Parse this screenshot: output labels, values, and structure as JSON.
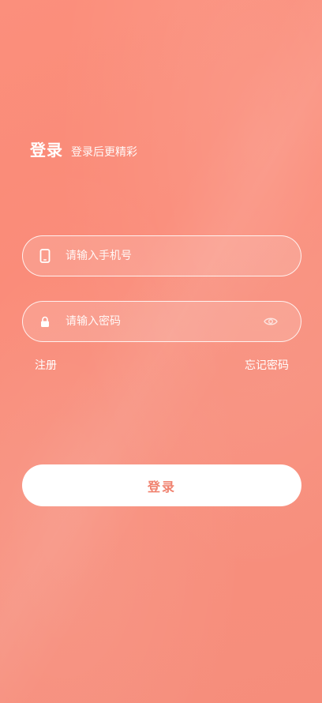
{
  "header": {
    "title": "登录",
    "subtitle": "登录后更精彩"
  },
  "phone_field": {
    "icon": "phone-icon",
    "placeholder": "请输入手机号",
    "value": ""
  },
  "password_field": {
    "icon": "lock-icon",
    "placeholder": "请输入密码",
    "value": "",
    "toggle_icon": "eye-icon"
  },
  "links": {
    "register": "注册",
    "forgot_password": "忘记密码"
  },
  "login_button": {
    "label": "登录"
  },
  "colors": {
    "background": "#fa8a77",
    "button_text": "#f0826f",
    "white": "#ffffff"
  }
}
